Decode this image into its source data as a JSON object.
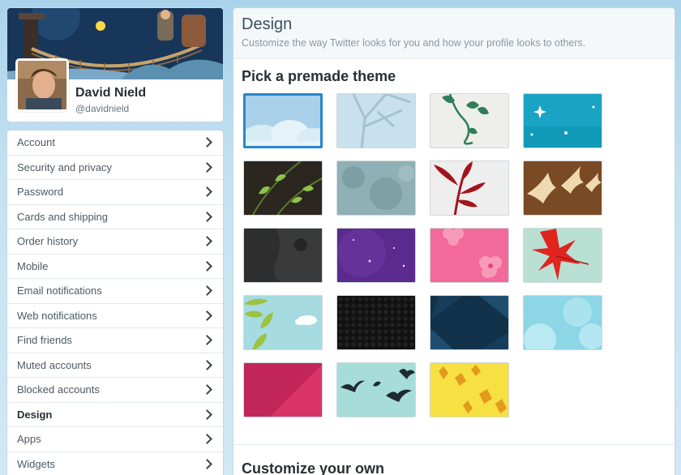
{
  "profile": {
    "name": "David Nield",
    "handle": "@davidnield"
  },
  "nav": {
    "items": [
      {
        "label": "Account"
      },
      {
        "label": "Security and privacy"
      },
      {
        "label": "Password"
      },
      {
        "label": "Cards and shipping"
      },
      {
        "label": "Order history"
      },
      {
        "label": "Mobile"
      },
      {
        "label": "Email notifications"
      },
      {
        "label": "Web notifications"
      },
      {
        "label": "Find friends"
      },
      {
        "label": "Muted accounts"
      },
      {
        "label": "Blocked accounts"
      },
      {
        "label": "Design",
        "active": true
      },
      {
        "label": "Apps"
      },
      {
        "label": "Widgets"
      }
    ]
  },
  "main": {
    "title": "Design",
    "subtitle": "Customize the way Twitter looks for you and how your profile looks to others.",
    "themes_heading": "Pick a premade theme",
    "customize_heading": "Customize your own",
    "selected_theme_index": 0,
    "themes": [
      {
        "name": "clouds",
        "colors": [
          "#a9d2ea",
          "#d8ecf6"
        ]
      },
      {
        "name": "branches",
        "colors": [
          "#c9e1ee",
          "#9dbfd2"
        ]
      },
      {
        "name": "vines",
        "colors": [
          "#eeeeea",
          "#2f7d5a"
        ]
      },
      {
        "name": "sparkles",
        "colors": [
          "#1aa3c4",
          "#6fd0e3"
        ]
      },
      {
        "name": "green-leaves",
        "colors": [
          "#2b2620",
          "#8fc24a"
        ]
      },
      {
        "name": "texture-teal",
        "colors": [
          "#8fb1b5",
          "#5f8489"
        ]
      },
      {
        "name": "red-plant",
        "colors": [
          "#eeeeee",
          "#a3141c"
        ]
      },
      {
        "name": "birds-brown",
        "colors": [
          "#7a4a24",
          "#efd9b0"
        ]
      },
      {
        "name": "dark-texture",
        "colors": [
          "#2b2b2b",
          "#3b3b3b"
        ]
      },
      {
        "name": "purple-stars",
        "colors": [
          "#5a2a8e",
          "#7e4cb6"
        ]
      },
      {
        "name": "pink-flowers",
        "colors": [
          "#f26a9a",
          "#f79ab8"
        ]
      },
      {
        "name": "red-leaf",
        "colors": [
          "#b9e0d3",
          "#e0241e"
        ]
      },
      {
        "name": "leaves-sky",
        "colors": [
          "#a6dbe2",
          "#9cc23f"
        ]
      },
      {
        "name": "hex-dark",
        "colors": [
          "#111111",
          "#2a2a2a"
        ]
      },
      {
        "name": "navy-rays",
        "colors": [
          "#12314a",
          "#1f4d70"
        ]
      },
      {
        "name": "bokeh-blue",
        "colors": [
          "#8dd6e6",
          "#c4edf5"
        ]
      },
      {
        "name": "magenta",
        "colors": [
          "#c2255a",
          "#d9346a"
        ]
      },
      {
        "name": "birds-mint",
        "colors": [
          "#a6ddd8",
          "#1d2a2f"
        ]
      },
      {
        "name": "yellow-leaves",
        "colors": [
          "#f7e041",
          "#e29b1d"
        ]
      }
    ]
  }
}
